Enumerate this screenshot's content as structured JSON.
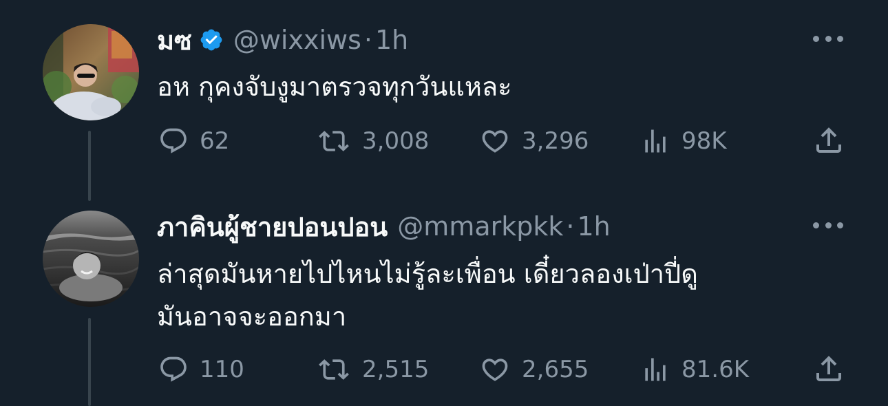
{
  "tweets": [
    {
      "display_name": "มซ",
      "verified": true,
      "handle": "@wixxiws",
      "dot": "·",
      "time": "1h",
      "text_lines": [
        "อห กุคงจับงูมาตรวจทุกวันแหละ"
      ],
      "replies": "62",
      "retweets": "3,008",
      "likes": "3,296",
      "views": "98K"
    },
    {
      "display_name": "ภาคินผู้ชายปอนปอน",
      "verified": false,
      "handle": "@mmarkpkk",
      "dot": "·",
      "time": "1h",
      "text_lines": [
        "ล่าสุดมันหายไปไหนไม่รู้ละเพื่อน เดี๋ยวลองเป่าปี่ดู",
        "มันอาจจะออกมา"
      ],
      "replies": "110",
      "retweets": "2,515",
      "likes": "2,655",
      "views": "81.6K"
    }
  ],
  "icons": {
    "reply": "reply-icon",
    "retweet": "retweet-icon",
    "like": "heart-icon",
    "views": "views-icon",
    "share": "share-icon",
    "more": "more-icon",
    "verified": "verified-badge-icon"
  },
  "colors": {
    "background": "#15202b",
    "text_primary": "#f7f9f9",
    "text_secondary": "#8b98a5",
    "verified_blue": "#1d9bf0",
    "thread_line": "#38444d"
  }
}
